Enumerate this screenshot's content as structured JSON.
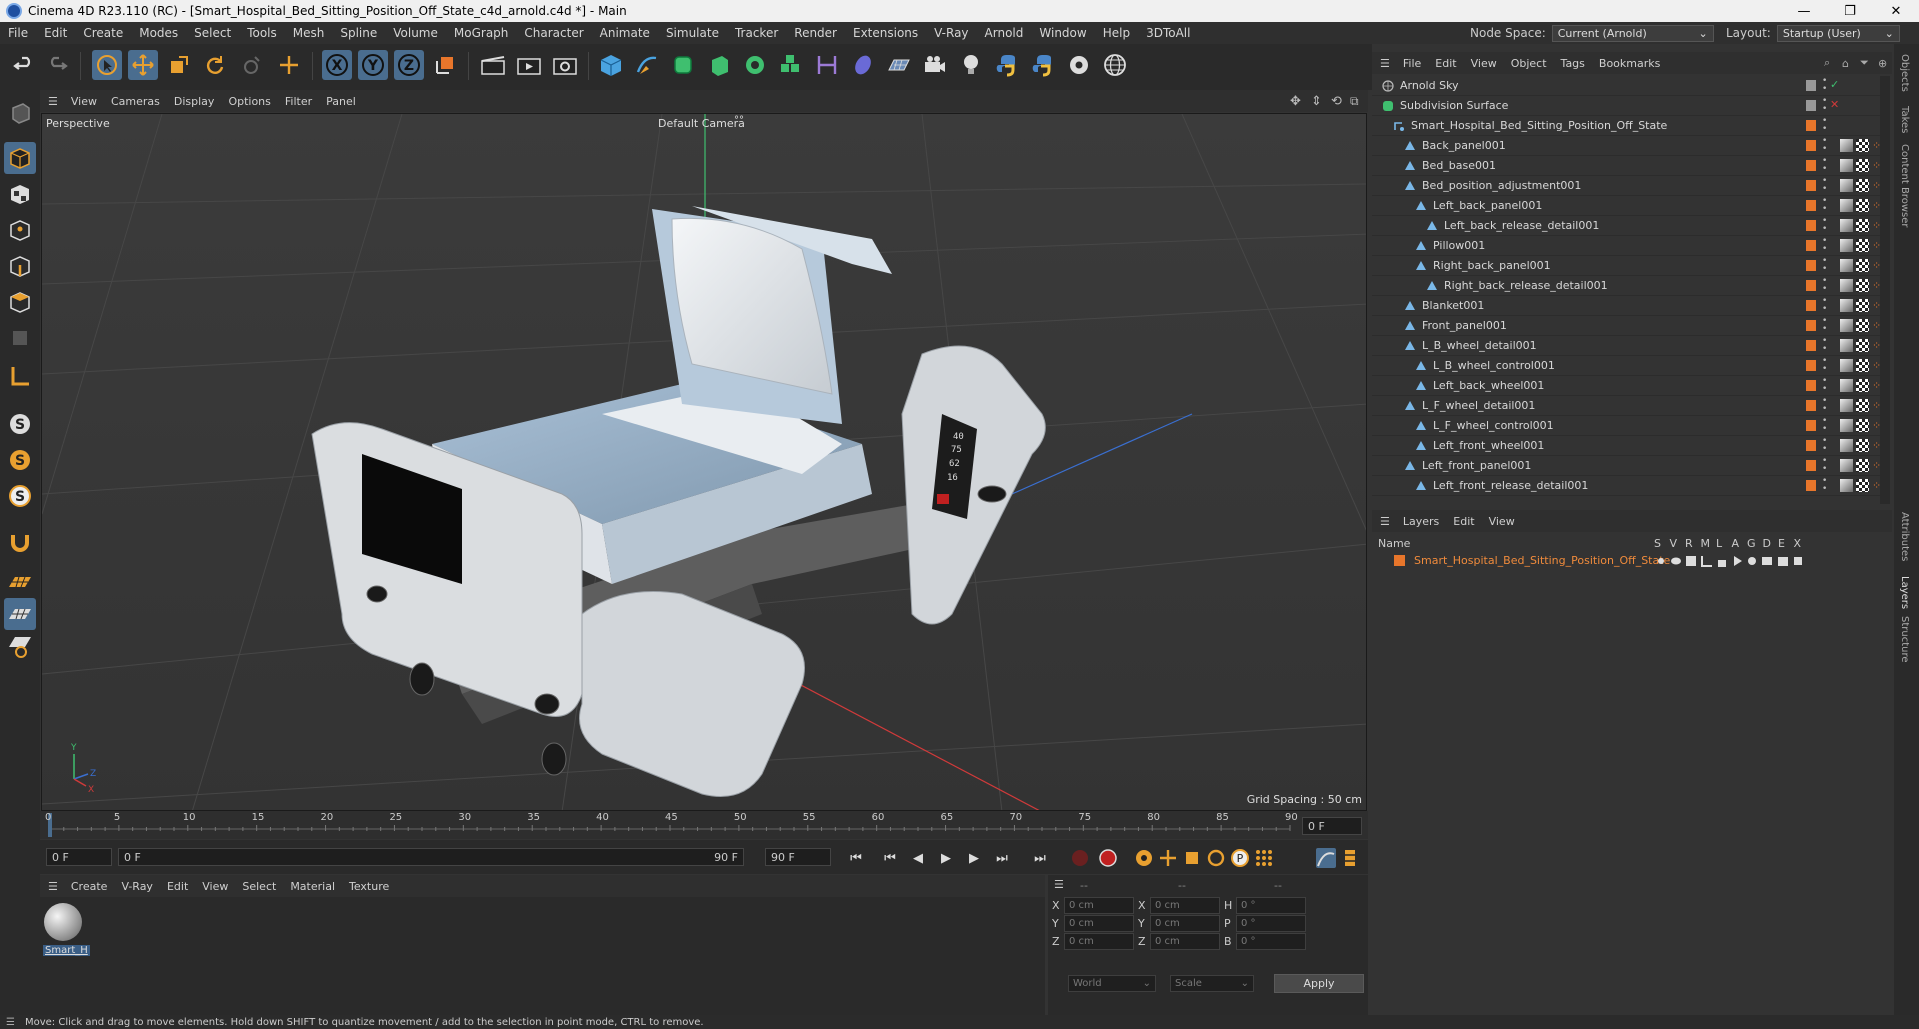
{
  "window": {
    "title": "Cinema 4D R23.110 (RC) - [Smart_Hospital_Bed_Sitting_Position_Off_State_c4d_arnold.c4d *] - Main",
    "controls": [
      "—",
      "❐",
      "✕"
    ]
  },
  "menubar": {
    "items": [
      "File",
      "Edit",
      "Create",
      "Modes",
      "Select",
      "Tools",
      "Mesh",
      "Spline",
      "Volume",
      "MoGraph",
      "Character",
      "Animate",
      "Simulate",
      "Tracker",
      "Render",
      "Extensions",
      "V-Ray",
      "Arnold",
      "Window",
      "Help",
      "3DToAll"
    ],
    "node_space_label": "Node Space:",
    "node_space_value": "Current (Arnold)",
    "layout_label": "Layout:",
    "layout_value": "Startup (User)"
  },
  "viewport": {
    "menu": [
      "View",
      "Cameras",
      "Display",
      "Options",
      "Filter",
      "Panel"
    ],
    "projection": "Perspective",
    "camera": "Default Camera",
    "grid_spacing": "Grid Spacing : 50 cm",
    "axis_labels": {
      "y": "Y",
      "z": "Z",
      "x": "X"
    },
    "monitor_text": [
      "40",
      "75",
      "62",
      "16"
    ]
  },
  "timeline": {
    "ticks": [
      "0",
      "5",
      "10",
      "15",
      "20",
      "25",
      "30",
      "35",
      "40",
      "45",
      "50",
      "55",
      "60",
      "65",
      "70",
      "75",
      "80",
      "85",
      "90"
    ],
    "current_frame_right": "0 F",
    "start_field": "0 F",
    "range_start": "0 F",
    "range_end": "90 F",
    "end_field": "90 F"
  },
  "material_panel": {
    "menu": [
      "Create",
      "V-Ray",
      "Edit",
      "View",
      "Select",
      "Material",
      "Texture"
    ],
    "material_name": "Smart_H"
  },
  "coordinates": {
    "headers": [
      "--",
      "--",
      "--"
    ],
    "rows": [
      {
        "a": "X",
        "av": "0 cm",
        "b": "X",
        "bv": "0 cm",
        "c": "H",
        "cv": "0 °"
      },
      {
        "a": "Y",
        "av": "0 cm",
        "b": "Y",
        "bv": "0 cm",
        "c": "P",
        "cv": "0 °"
      },
      {
        "a": "Z",
        "av": "0 cm",
        "b": "Z",
        "bv": "0 cm",
        "c": "B",
        "cv": "0 °"
      }
    ],
    "space": "World",
    "mode": "Scale",
    "apply": "Apply"
  },
  "object_manager": {
    "menu": [
      "File",
      "Edit",
      "View",
      "Object",
      "Tags",
      "Bookmarks"
    ],
    "objects": [
      {
        "name": "Arnold Sky",
        "indent": 0,
        "type": "sky"
      },
      {
        "name": "Subdivision Surface",
        "indent": 0,
        "type": "subd"
      },
      {
        "name": "Smart_Hospital_Bed_Sitting_Position_Off_State",
        "indent": 1,
        "type": "null"
      },
      {
        "name": "Back_panel001",
        "indent": 2,
        "type": "mesh"
      },
      {
        "name": "Bed_base001",
        "indent": 2,
        "type": "mesh"
      },
      {
        "name": "Bed_position_adjustment001",
        "indent": 2,
        "type": "mesh"
      },
      {
        "name": "Left_back_panel001",
        "indent": 3,
        "type": "mesh"
      },
      {
        "name": "Left_back_release_detail001",
        "indent": 4,
        "type": "mesh"
      },
      {
        "name": "Pillow001",
        "indent": 3,
        "type": "mesh"
      },
      {
        "name": "Right_back_panel001",
        "indent": 3,
        "type": "mesh"
      },
      {
        "name": "Right_back_release_detail001",
        "indent": 4,
        "type": "mesh"
      },
      {
        "name": "Blanket001",
        "indent": 2,
        "type": "mesh"
      },
      {
        "name": "Front_panel001",
        "indent": 2,
        "type": "mesh"
      },
      {
        "name": "L_B_wheel_detail001",
        "indent": 2,
        "type": "mesh"
      },
      {
        "name": "L_B_wheel_control001",
        "indent": 3,
        "type": "mesh"
      },
      {
        "name": "Left_back_wheel001",
        "indent": 3,
        "type": "mesh"
      },
      {
        "name": "L_F_wheel_detail001",
        "indent": 2,
        "type": "mesh"
      },
      {
        "name": "L_F_wheel_control001",
        "indent": 3,
        "type": "mesh"
      },
      {
        "name": "Left_front_wheel001",
        "indent": 3,
        "type": "mesh"
      },
      {
        "name": "Left_front_panel001",
        "indent": 2,
        "type": "mesh"
      },
      {
        "name": "Left_front_release_detail001",
        "indent": 3,
        "type": "mesh"
      }
    ]
  },
  "layers": {
    "menu": [
      "Layers",
      "Edit",
      "View"
    ],
    "name_header": "Name",
    "flag_headers": [
      "S",
      "V",
      "R",
      "M",
      "L",
      "A",
      "G",
      "D",
      "E",
      "X"
    ],
    "items": [
      {
        "name": "Smart_Hospital_Bed_Sitting_Position_Off_State",
        "color": "#e8762b"
      }
    ]
  },
  "side_tabs": [
    "Objects",
    "Takes",
    "Content Browser",
    "Attributes",
    "Layers",
    "Structure"
  ],
  "status": "Move: Click and drag to move elements. Hold down SHIFT to quantize movement / add to the selection in point mode, CTRL to remove.",
  "colors": {
    "accent": "#4a6d8f",
    "orange": "#e8762b",
    "layer_name": "#f08b3c",
    "green_axis": "#3fbf6f",
    "red_axis": "#d03a3a",
    "blue_axis": "#3a6fd0"
  }
}
